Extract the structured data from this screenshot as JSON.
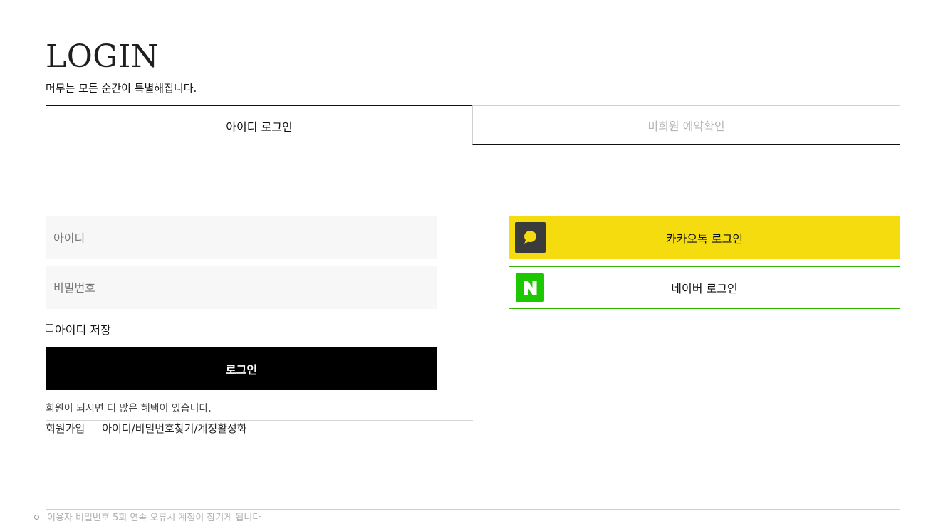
{
  "header": {
    "title": "LOGIN",
    "subtitle": "머무는 모든 순간이 특별해집니다."
  },
  "tabs": [
    {
      "label": "아이디 로그인",
      "active": true
    },
    {
      "label": "비회원 예약확인",
      "active": false
    }
  ],
  "form": {
    "id_placeholder": "아이디",
    "password_placeholder": "비밀번호",
    "remember_label": "아이디 저장",
    "remember_checked": false,
    "login_label": "로그인",
    "benefit_text": "회원이 되시면 더 많은 혜택이 있습니다.",
    "join_label": "회원가입",
    "find_label": "아이디/비밀번호찾기/계정활성화"
  },
  "social": {
    "kakao_label": "카카오톡 로그인",
    "kakao_icon": "kakao-talk-icon",
    "naver_label": "네이버 로그인",
    "naver_icon": "naver-n-icon"
  },
  "footer": {
    "notice": "이용자 비밀번호 5회 연속 오류시 계정이 잠기게 됩니다"
  },
  "colors": {
    "kakao": "#f5dc0f",
    "naver": "#1ec800",
    "login_button": "#000000",
    "inactive_tab_text": "#b5b5b5"
  }
}
